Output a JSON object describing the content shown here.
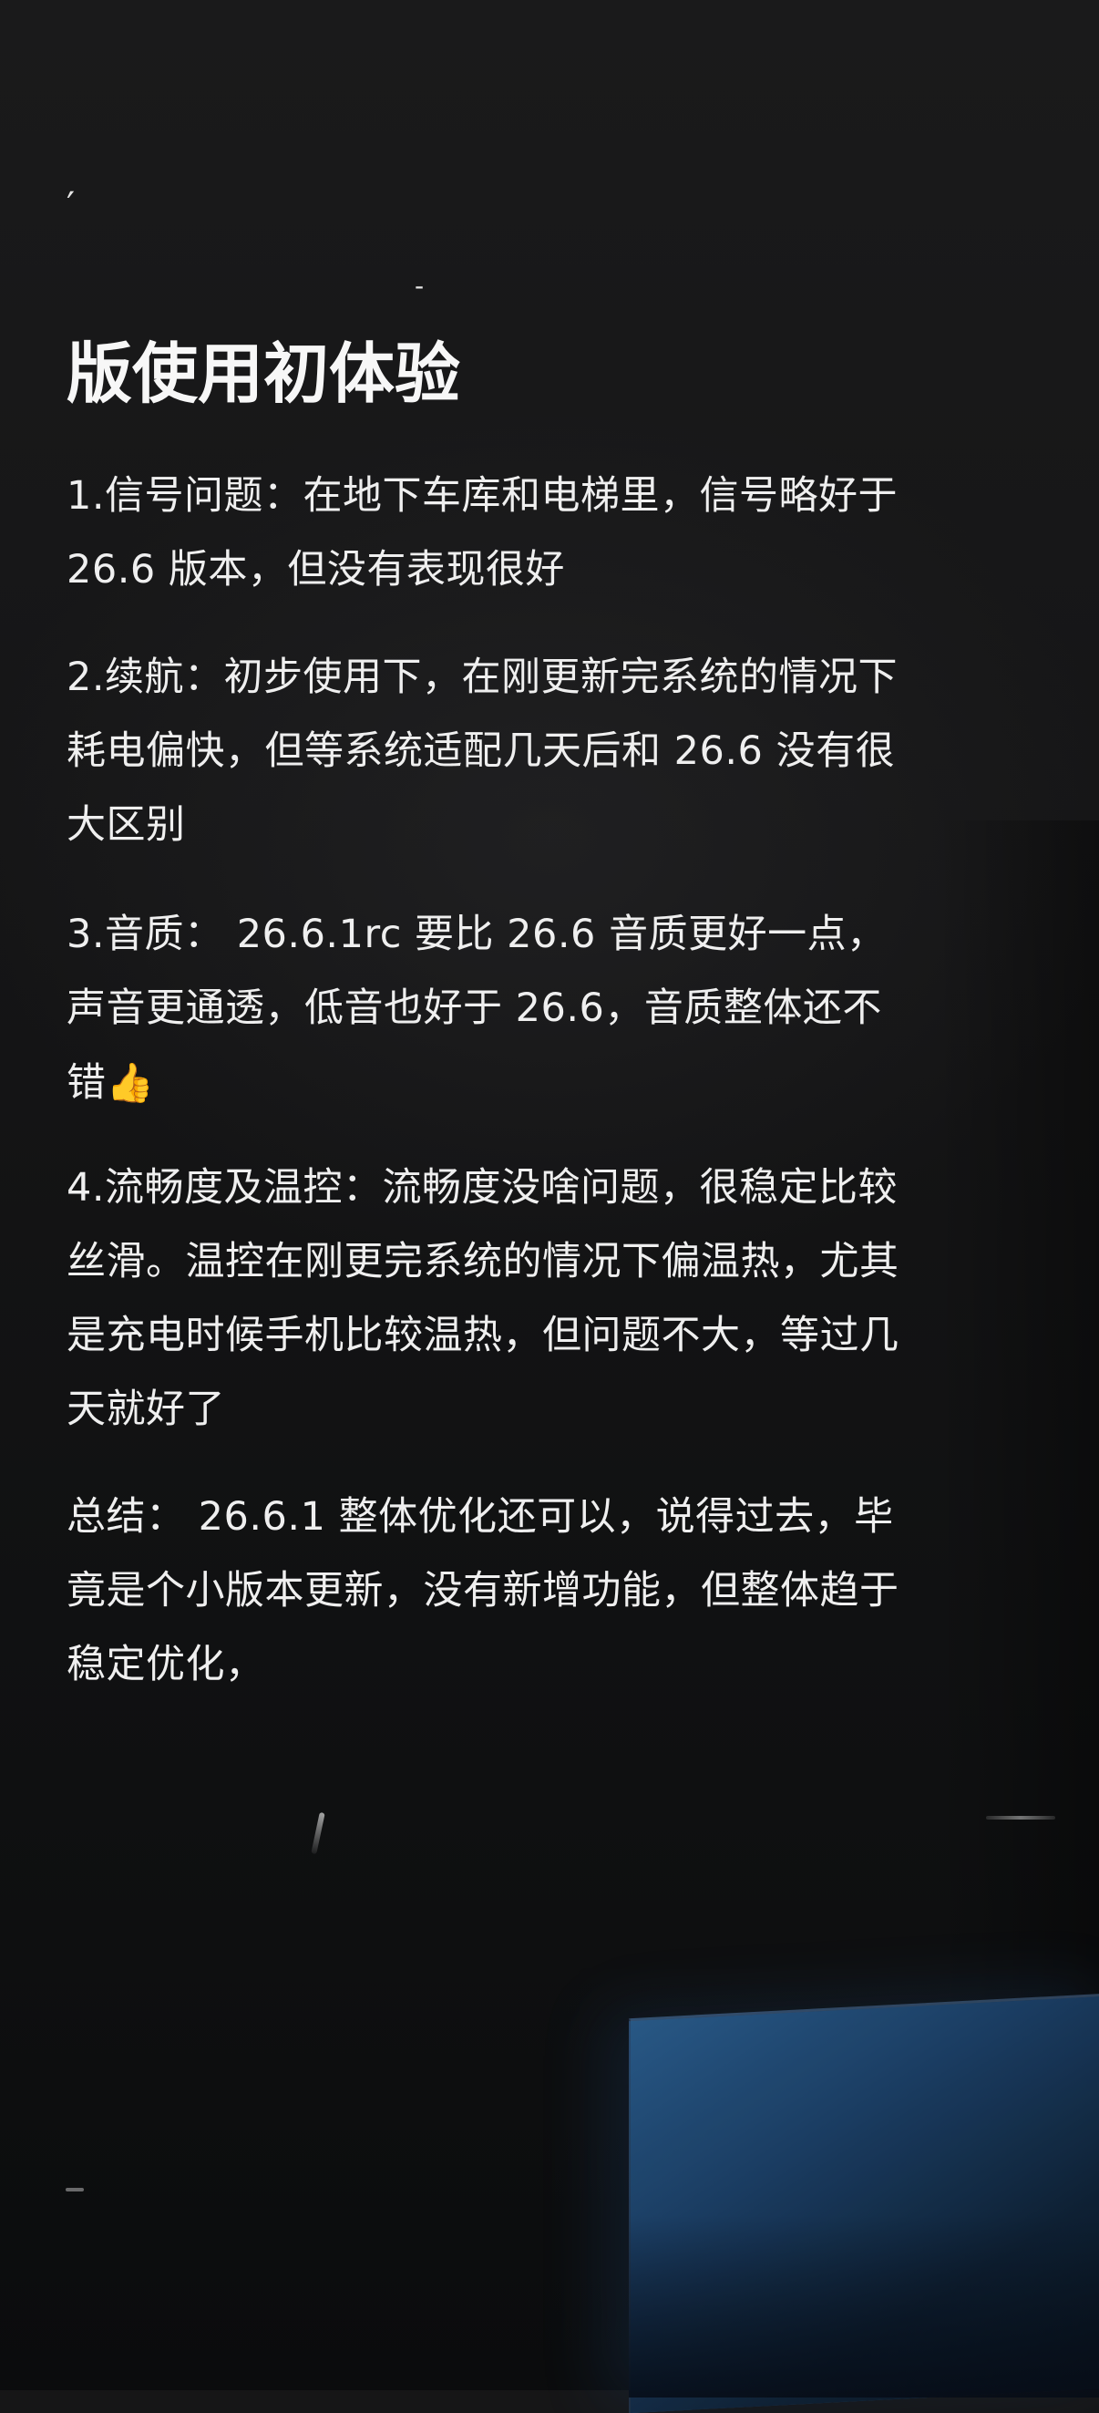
{
  "marks": {
    "top_left": "′",
    "top_mid": "-"
  },
  "title": "版使用初体验",
  "paragraphs": {
    "p1": "1.信号问题：在地下车库和电梯里，信号略好于 26.6 版本，但没有表现很好",
    "p2": "2.续航：初步使用下，在刚更新完系统的情况下耗电偏快，但等系统适配几天后和 26.6 没有很大区别",
    "p3": "3.音质： 26.6.1rc 要比 26.6 音质更好一点，声音更通透，低音也好于 26.6，音质整体还不错",
    "p3_emoji": "👍",
    "p4": "4.流畅度及温控：流畅度没啥问题，很稳定比较丝滑。温控在刚更完系统的情况下偏温热，尤其是充电时候手机比较温热，但问题不大，等过几天就好了",
    "p5": "总结： 26.6.1 整体优化还可以，说得过去，毕竟是个小版本更新，没有新增功能，但整体趋于稳定优化，"
  },
  "icons": {
    "thumbs_up": "thumbs-up-icon"
  },
  "colors": {
    "background": "#161617",
    "text": "#efefef",
    "accent_shape": "#2a5c8c"
  }
}
